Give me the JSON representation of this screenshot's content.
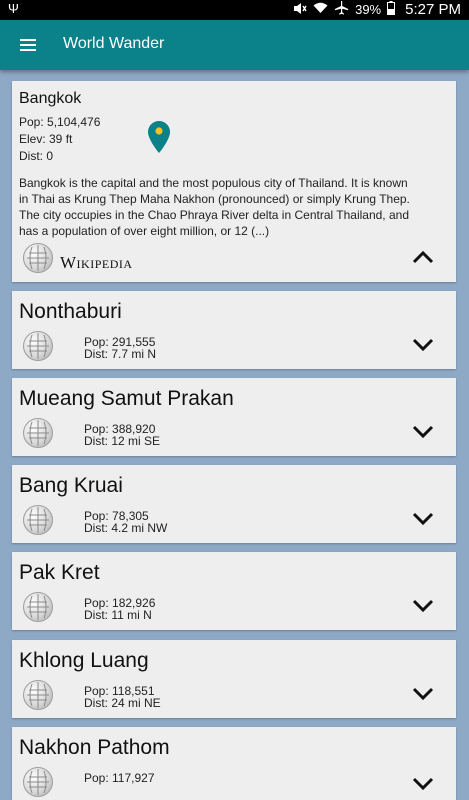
{
  "status_bar": {
    "battery": "39%",
    "time": "5:27 PM"
  },
  "app_bar": {
    "title": "World Wander"
  },
  "selected_city": {
    "name": "Bangkok",
    "pop": "Pop: 5,104,476",
    "elev": "Elev: 39 ft",
    "dist": "Dist: 0",
    "description": "Bangkok is the capital and the most populous city of Thailand. It is known in Thai as Krung Thep Maha Nakhon (pronounced) or simply Krung Thep. The city occupies in the Chao Phraya River delta in Central Thailand, and has a population of over eight million, or 12 (...)",
    "wikipedia_label": "Wikipedia",
    "pin_color": "#0b8189"
  },
  "cities": [
    {
      "name": "Nonthaburi",
      "pop": "Pop: 291,555",
      "dist": "Dist: 7.7 mi  N"
    },
    {
      "name": "Mueang Samut Prakan",
      "pop": "Pop: 388,920",
      "dist": "Dist: 12 mi  SE"
    },
    {
      "name": "Bang Kruai",
      "pop": "Pop: 78,305",
      "dist": "Dist: 4.2 mi  NW"
    },
    {
      "name": "Pak Kret",
      "pop": "Pop: 182,926",
      "dist": "Dist: 11 mi  N"
    },
    {
      "name": "Khlong Luang",
      "pop": "Pop: 118,551",
      "dist": "Dist: 24 mi  NE"
    },
    {
      "name": "Nakhon Pathom",
      "pop": "Pop: 117,927",
      "dist": ""
    }
  ],
  "colors": {
    "app_bar": "#0b8189",
    "background": "#8ea9c6",
    "card": "#eeeeee"
  }
}
